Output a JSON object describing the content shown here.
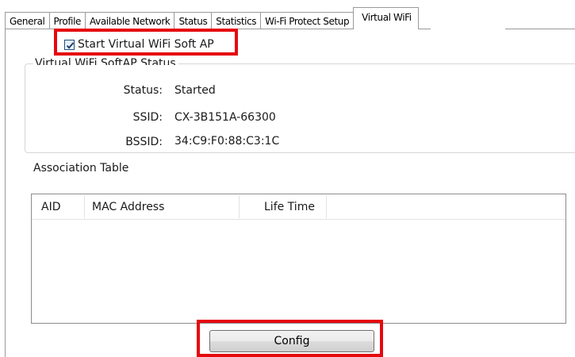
{
  "tabs": [
    {
      "label": "General"
    },
    {
      "label": "Profile"
    },
    {
      "label": "Available Network"
    },
    {
      "label": "Status"
    },
    {
      "label": "Statistics"
    },
    {
      "label": "Wi-Fi Protect Setup"
    },
    {
      "label": "Virtual WiFi",
      "active": true
    }
  ],
  "softap": {
    "checkbox_label": "Start Virtual WiFi Soft AP",
    "checked": true
  },
  "status_group": {
    "title": "Virtual WiFi SoftAP Status",
    "status_label": "Status:",
    "status_value": "Started",
    "ssid_label": "SSID:",
    "ssid_value": "CX-3B151A-66300",
    "bssid_label": "BSSID:",
    "bssid_value": "34:C9:F0:88:C3:1C"
  },
  "association": {
    "title": "Association Table",
    "columns": [
      "AID",
      "MAC Address",
      "Life Time"
    ],
    "rows": []
  },
  "config_button": {
    "label": "Config"
  },
  "colors": {
    "highlight": "#e5080e",
    "check_mark": "#1c3f6e"
  }
}
